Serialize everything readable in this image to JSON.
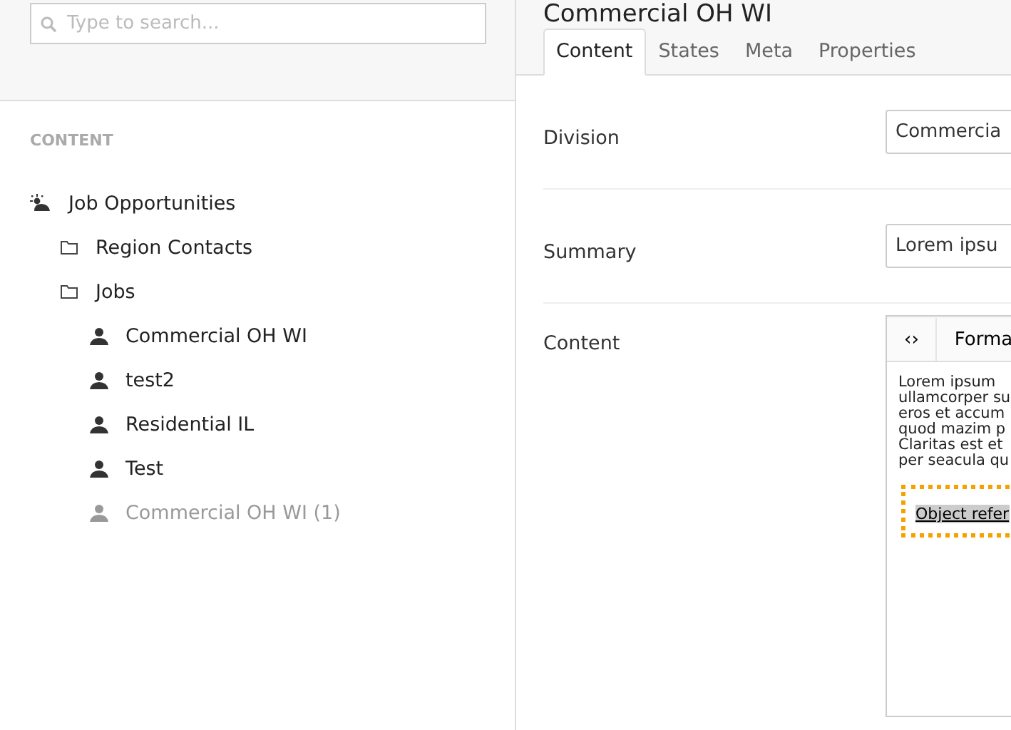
{
  "search": {
    "placeholder": "Type to search..."
  },
  "sidebar": {
    "heading": "CONTENT",
    "tree": [
      {
        "kind": "site",
        "label": "Job Opportunities",
        "disabled": false,
        "children": [
          {
            "kind": "folder",
            "label": "Region Contacts",
            "disabled": false
          },
          {
            "kind": "folder",
            "label": "Jobs",
            "disabled": false,
            "children": [
              {
                "kind": "person",
                "label": "Commercial OH WI",
                "disabled": false
              },
              {
                "kind": "person",
                "label": "test2",
                "disabled": false
              },
              {
                "kind": "person",
                "label": "Residential IL",
                "disabled": false
              },
              {
                "kind": "person",
                "label": "Test",
                "disabled": false
              },
              {
                "kind": "person",
                "label": "Commercial OH WI (1)",
                "disabled": true
              }
            ]
          }
        ]
      }
    ]
  },
  "page": {
    "title": "Commercial OH WI",
    "tabs": [
      {
        "label": "Content",
        "selected": true
      },
      {
        "label": "States",
        "selected": false
      },
      {
        "label": "Meta",
        "selected": false
      },
      {
        "label": "Properties",
        "selected": false
      }
    ],
    "fields": [
      {
        "kind": "input",
        "label": "Division",
        "value": "Commercia"
      },
      {
        "kind": "input",
        "label": "Summary",
        "value": "Lorem ipsu"
      },
      {
        "kind": "editor",
        "label": "Content",
        "toolbar": [
          "‹›",
          "Forma"
        ],
        "lines": [
          "Lorem ipsum",
          "ullamcorper su",
          "eros et accum",
          "quod mazim p",
          "Claritas est et",
          "per seacula qu"
        ],
        "reference": "Object refer"
      }
    ]
  }
}
